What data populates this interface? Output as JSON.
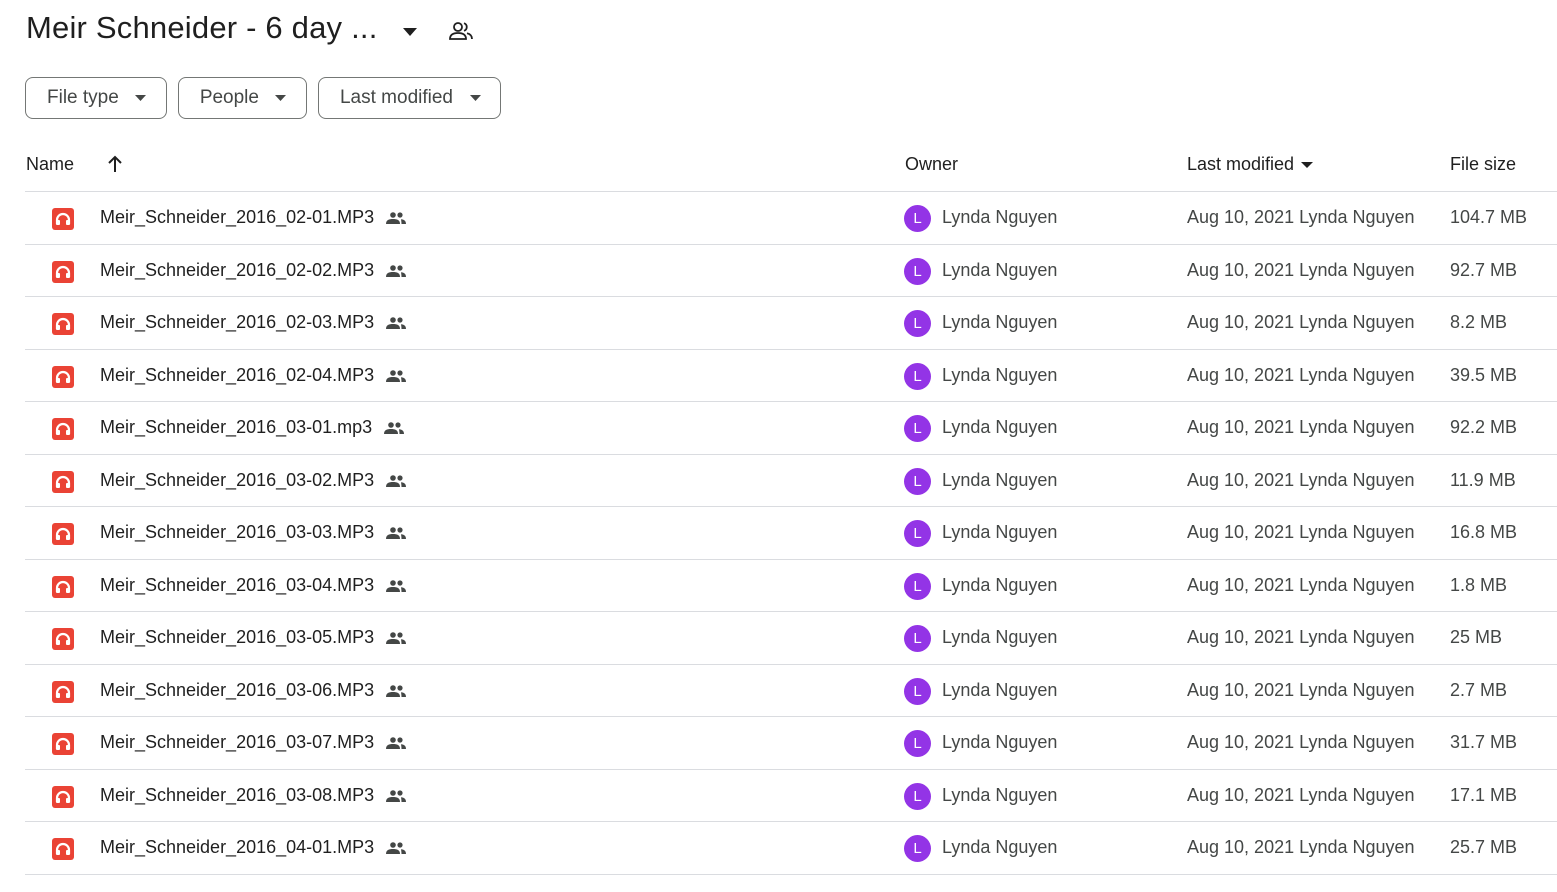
{
  "header": {
    "title": "Meir Schneider - 6 day ...",
    "title_menu_icon": "arrow-drop-down-icon",
    "shared_folder_icon": "people-outline-icon"
  },
  "filters": [
    {
      "label": "File type",
      "icon": "arrow-drop-down-icon"
    },
    {
      "label": "People",
      "icon": "arrow-drop-down-icon"
    },
    {
      "label": "Last modified",
      "icon": "arrow-drop-down-icon"
    }
  ],
  "columns": {
    "name": "Name",
    "owner": "Owner",
    "last_modified": "Last modified",
    "file_size": "File size"
  },
  "colors": {
    "audio_icon": "#ea4335",
    "avatar": "#9334e6",
    "divider": "#dadce0",
    "chip_border": "#747775"
  },
  "files": [
    {
      "name": "Meir_Schneider_2016_02-01.MP3",
      "owner_initial": "L",
      "owner": "Lynda Nguyen",
      "modified": "Aug 10, 2021 Lynda Nguyen",
      "size": "104.7 MB"
    },
    {
      "name": "Meir_Schneider_2016_02-02.MP3",
      "owner_initial": "L",
      "owner": "Lynda Nguyen",
      "modified": "Aug 10, 2021 Lynda Nguyen",
      "size": "92.7 MB"
    },
    {
      "name": "Meir_Schneider_2016_02-03.MP3",
      "owner_initial": "L",
      "owner": "Lynda Nguyen",
      "modified": "Aug 10, 2021 Lynda Nguyen",
      "size": "8.2 MB"
    },
    {
      "name": "Meir_Schneider_2016_02-04.MP3",
      "owner_initial": "L",
      "owner": "Lynda Nguyen",
      "modified": "Aug 10, 2021 Lynda Nguyen",
      "size": "39.5 MB"
    },
    {
      "name": "Meir_Schneider_2016_03-01.mp3",
      "owner_initial": "L",
      "owner": "Lynda Nguyen",
      "modified": "Aug 10, 2021 Lynda Nguyen",
      "size": "92.2 MB"
    },
    {
      "name": "Meir_Schneider_2016_03-02.MP3",
      "owner_initial": "L",
      "owner": "Lynda Nguyen",
      "modified": "Aug 10, 2021 Lynda Nguyen",
      "size": "11.9 MB"
    },
    {
      "name": "Meir_Schneider_2016_03-03.MP3",
      "owner_initial": "L",
      "owner": "Lynda Nguyen",
      "modified": "Aug 10, 2021 Lynda Nguyen",
      "size": "16.8 MB"
    },
    {
      "name": "Meir_Schneider_2016_03-04.MP3",
      "owner_initial": "L",
      "owner": "Lynda Nguyen",
      "modified": "Aug 10, 2021 Lynda Nguyen",
      "size": "1.8 MB"
    },
    {
      "name": "Meir_Schneider_2016_03-05.MP3",
      "owner_initial": "L",
      "owner": "Lynda Nguyen",
      "modified": "Aug 10, 2021 Lynda Nguyen",
      "size": "25 MB"
    },
    {
      "name": "Meir_Schneider_2016_03-06.MP3",
      "owner_initial": "L",
      "owner": "Lynda Nguyen",
      "modified": "Aug 10, 2021 Lynda Nguyen",
      "size": "2.7 MB"
    },
    {
      "name": "Meir_Schneider_2016_03-07.MP3",
      "owner_initial": "L",
      "owner": "Lynda Nguyen",
      "modified": "Aug 10, 2021 Lynda Nguyen",
      "size": "31.7 MB"
    },
    {
      "name": "Meir_Schneider_2016_03-08.MP3",
      "owner_initial": "L",
      "owner": "Lynda Nguyen",
      "modified": "Aug 10, 2021 Lynda Nguyen",
      "size": "17.1 MB"
    },
    {
      "name": "Meir_Schneider_2016_04-01.MP3",
      "owner_initial": "L",
      "owner": "Lynda Nguyen",
      "modified": "Aug 10, 2021 Lynda Nguyen",
      "size": "25.7 MB"
    }
  ]
}
